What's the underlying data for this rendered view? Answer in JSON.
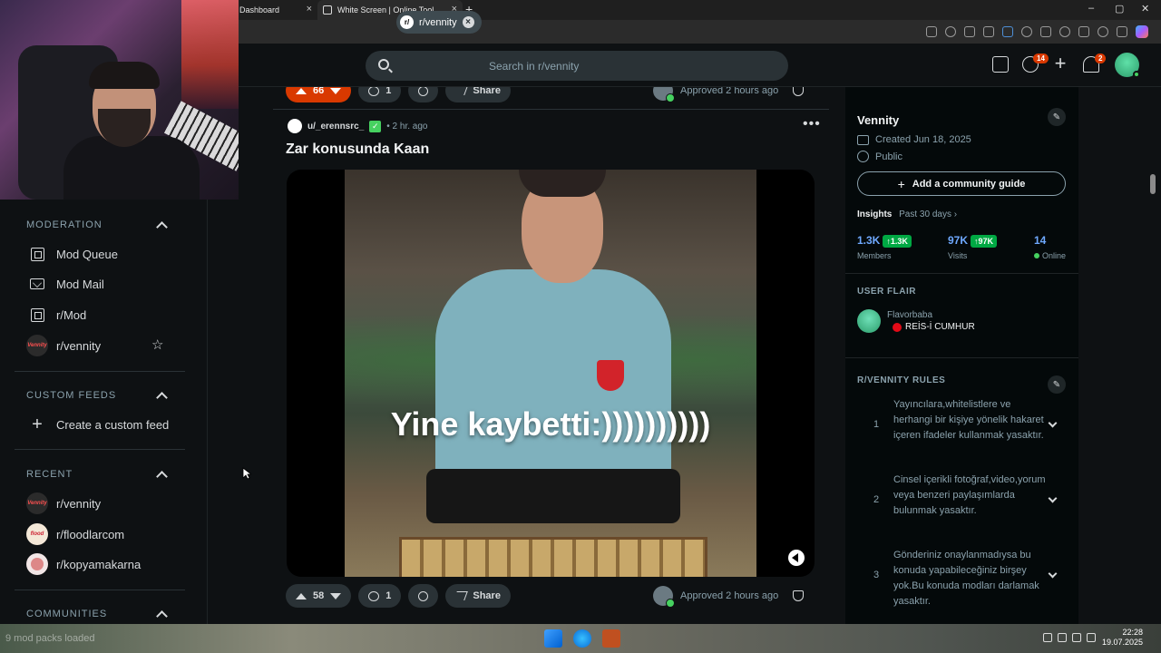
{
  "browser": {
    "tabs": [
      {
        "label": "Dashboard"
      },
      {
        "label": "White Screen | Online Tool"
      }
    ],
    "new_tab": "+",
    "window_controls": [
      "–",
      "▢",
      "✕"
    ]
  },
  "header": {
    "search_chip": "r/vennity",
    "search_chip_avatar": "r/",
    "search_placeholder": "Search in r/vennity",
    "chat_badge": "14",
    "notif_badge": "2"
  },
  "sidebar": {
    "moderation": {
      "title": "MODERATION",
      "items": [
        {
          "label": "Mod Queue",
          "icon": "mod-queue-icon"
        },
        {
          "label": "Mod Mail",
          "icon": "mail-icon"
        },
        {
          "label": "r/Mod",
          "icon": "mod-icon"
        },
        {
          "label": "r/vennity",
          "icon": "community-avatar"
        }
      ]
    },
    "custom_feeds": {
      "title": "CUSTOM FEEDS",
      "create_label": "Create a custom feed"
    },
    "recent": {
      "title": "RECENT",
      "items": [
        {
          "label": "r/vennity"
        },
        {
          "label": "r/floodlarcom"
        },
        {
          "label": "r/kopyamakarna"
        }
      ]
    },
    "communities": {
      "title": "COMMUNITIES"
    },
    "avatar_text_vennity": "Vennity",
    "avatar_text_flood": "flood"
  },
  "feed": {
    "top_actions": {
      "votes": "66",
      "comments": "1",
      "share": "Share",
      "approved": "Approved 2 hours ago"
    },
    "post": {
      "user": "u/_erennsrc_",
      "flair_mark": "✓",
      "time": "• 2 hr. ago",
      "title": "Zar konusunda Kaan",
      "caption": "Yine kaybetti:))))))))))",
      "votes": "58",
      "comments": "1",
      "share": "Share",
      "approved": "Approved 2 hours ago",
      "menu": "•••"
    }
  },
  "right": {
    "community": {
      "name": "Vennity",
      "created": "Created Jun 18, 2025",
      "visibility": "Public",
      "guide_button": "Add a community guide",
      "insights_label": "Insights",
      "insights_range": "Past 30 days ›",
      "members_value": "1.3K",
      "members_delta": "↑1.3K",
      "members_label": "Members",
      "visits_value": "97K",
      "visits_delta": "↑97K",
      "visits_label": "Visits",
      "online_value": "14",
      "online_label": "Online"
    },
    "user_flair": {
      "title": "USER FLAIR",
      "name": "Flavorbaba",
      "flair": "REİS-İ CUMHUR"
    },
    "rules": {
      "title": "R/VENNITY RULES",
      "items": [
        {
          "n": "1",
          "text": "Yayıncılara,whitelistlere ve herhangi bir kişiye yönelik hakaret içeren ifadeler kullanmak yasaktır."
        },
        {
          "n": "2",
          "text": "Cinsel içerikli fotoğraf,video,yorum veya benzeri paylaşımlarda bulunmak yasaktır."
        },
        {
          "n": "3",
          "text": "Gönderiniz onaylanmadıysa bu konuda yapabileceğiniz birşey yok.Bu konuda modları darlamak yasaktır."
        }
      ]
    }
  },
  "taskbar": {
    "left_text": "9 mod packs loaded",
    "time": "22:28",
    "date": "19.07.2025"
  },
  "colors": {
    "upvote_active": "#d93900",
    "accent_green": "#46d160",
    "insight_blue": "#6fa9ff",
    "background": "#0e1113"
  }
}
